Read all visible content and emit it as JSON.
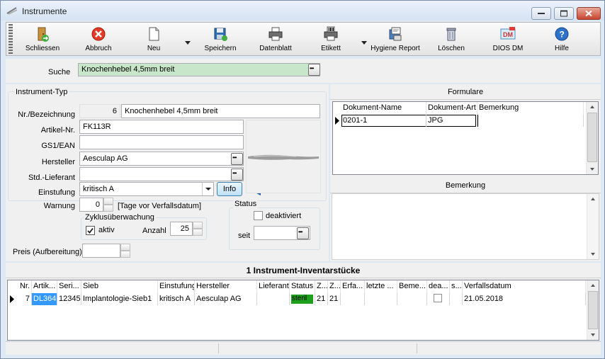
{
  "window": {
    "title": "Instrumente"
  },
  "toolbar": {
    "schliessen": "Schliessen",
    "abbruch": "Abbruch",
    "neu": "Neu",
    "speichern": "Speichern",
    "datenblatt": "Datenblatt",
    "etikett": "Etikett",
    "hygiene_report": "Hygiene Report",
    "loeschen": "Löschen",
    "dios_dm": "DIOS DM",
    "hilfe": "Hilfe"
  },
  "search": {
    "label": "Suche",
    "value": "Knochenhebel 4,5mm breit"
  },
  "instrument_typ": {
    "group_title": "Instrument-Typ",
    "nr_label": "Nr./Bezeichnung",
    "nr_value": "6",
    "bezeichnung_value": "Knochenhebel 4,5mm breit",
    "artikel_label": "Artikel-Nr.",
    "artikel_value": "FK113R",
    "gs1_label": "GS1/EAN",
    "gs1_value": "",
    "hersteller_label": "Hersteller",
    "hersteller_value": "Aesculap AG",
    "lieferant_label": "Std.-Lieferant",
    "lieferant_value": "",
    "einstufung_label": "Einstufung",
    "einstufung_value": "kritisch A",
    "info_button": "Info",
    "warnung_label": "Warnung",
    "warnung_value": "0",
    "warnung_unit": "[Tage vor Verfallsdatum]",
    "zyklus_title": "Zyklusüberwachung",
    "aktiv_label": "aktiv",
    "anzahl_label": "Anzahl",
    "anzahl_value": "25",
    "status_title": "Status",
    "deaktiviert_label": "deaktiviert",
    "seit_label": "seit",
    "seit_value": "",
    "preis_label": "Preis (Aufbereitung)",
    "preis_value": ""
  },
  "formulare": {
    "title": "Formulare",
    "columns": [
      "Dokument-Name",
      "Dokument-Art",
      "Bemerkung"
    ],
    "rows": [
      {
        "name": "0201-1",
        "art": "JPG",
        "bemerkung": ""
      }
    ]
  },
  "bemerkung": {
    "title": "Bemerkung",
    "value": ""
  },
  "inventar": {
    "title": "1 Instrument-Inventarstücke",
    "columns": [
      "Nr.",
      "Artik...",
      "Seri...",
      "Sieb",
      "Einstufung",
      "Hersteller",
      "Lieferant",
      "Status",
      "Z...",
      "Z...",
      "Erfa...",
      "letzte ...",
      "Beme...",
      "dea...",
      "s...",
      "Verfallsdatum"
    ],
    "rows": [
      {
        "nr": "7",
        "artikel": "DL364",
        "serie": "12345(",
        "sieb": "Implantologie-Sieb1",
        "einstufung": "kritisch A",
        "hersteller": "Aesculap AG",
        "lieferant": "",
        "status": "steril",
        "z1": "21",
        "z2": "21",
        "erfa": "",
        "letzte": "",
        "beme": "",
        "s": "",
        "verfallsdatum": "21.05.2018"
      }
    ]
  },
  "colors": {
    "search_bg": "#c8e6c9",
    "status_steril": "#1e9f1e",
    "selection": "#3399ff",
    "arrow": "#1f5aa8"
  }
}
